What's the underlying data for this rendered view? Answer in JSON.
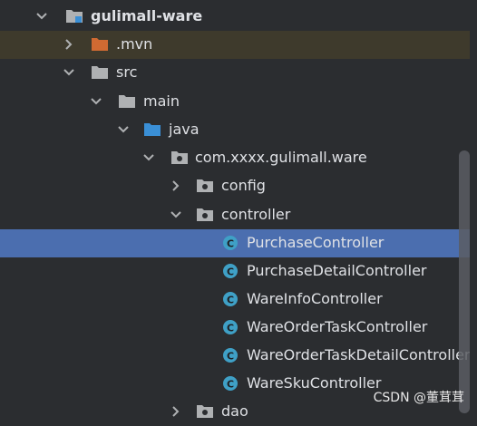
{
  "tree": {
    "items": [
      {
        "label": "gulimall-ware"
      },
      {
        "label": ".mvn"
      },
      {
        "label": "src"
      },
      {
        "label": "main"
      },
      {
        "label": "java"
      },
      {
        "label": "com.xxxx.gulimall.ware"
      },
      {
        "label": "config"
      },
      {
        "label": "controller"
      },
      {
        "label": "PurchaseController"
      },
      {
        "label": "PurchaseDetailController"
      },
      {
        "label": "WareInfoController"
      },
      {
        "label": "WareOrderTaskController"
      },
      {
        "label": "WareOrderTaskDetailController"
      },
      {
        "label": "WareSkuController"
      },
      {
        "label": "dao"
      }
    ]
  },
  "watermark": "CSDN @董茸茸",
  "colors": {
    "background": "#2b2d30",
    "selected_row": "#4b6eaf",
    "mvn_row": "#3e3a2c",
    "folder_icon": "#afb1b3",
    "source_folder_icon": "#3a8fd6",
    "mvn_folder_icon": "#d06a32",
    "class_icon": "#3fa0c6"
  }
}
